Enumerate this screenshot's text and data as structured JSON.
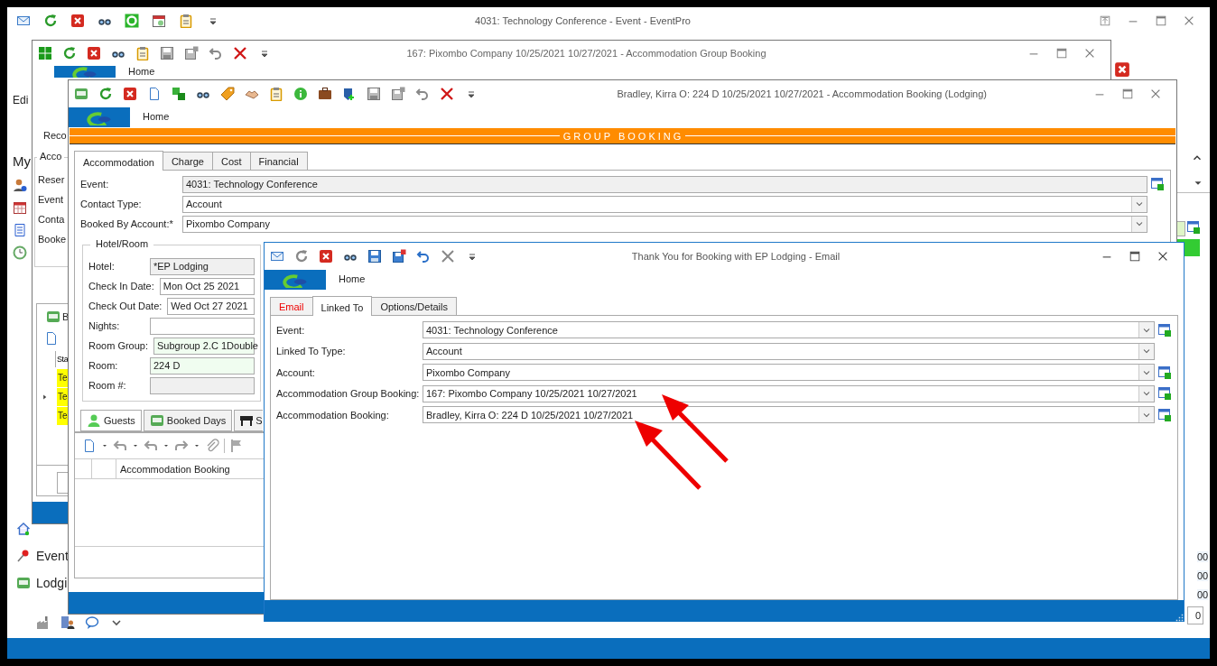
{
  "app_window": {
    "title": "4031: Technology Conference - Event - EventPro",
    "ribbon_label": "Edi",
    "panel_heading": "My",
    "nav_items": [
      {
        "label": "Event"
      },
      {
        "label": "Lodgi"
      }
    ],
    "list_values": [
      "00",
      "00",
      "00"
    ],
    "field_value": "0"
  },
  "group_booking_window": {
    "title": "167: Pixombo Company 10/25/2021 10/27/2021 - Accommodation Group Booking",
    "ribbon_tab": "Home",
    "tab": "Reco",
    "group_title": "Acco",
    "field_labels": [
      "Reser",
      "Event",
      "Conta",
      "Booke"
    ],
    "grid_tab": "B",
    "grid_column": "Sta",
    "grid_rows": [
      {
        "cell": "Te",
        "selected": false
      },
      {
        "cell": "Te",
        "selected": true
      },
      {
        "cell": "Te",
        "selected": false
      }
    ]
  },
  "accommodation_window": {
    "title": "Bradley, Kirra O: 224 D 10/25/2021 10/27/2021  - Accommodation Booking (Lodging)",
    "ribbon_tab": "Home",
    "banner": "GROUP BOOKING",
    "tabs": [
      {
        "label": "Accommodation",
        "selected": true
      },
      {
        "label": "Charge",
        "selected": false
      },
      {
        "label": "Cost",
        "selected": false
      },
      {
        "label": "Financial",
        "selected": false
      }
    ],
    "fields": [
      {
        "label": "Event:",
        "value": "4031: Technology Conference",
        "kind": "readonly",
        "lookup": true
      },
      {
        "label": "Contact Type:",
        "value": "Account",
        "kind": "dropdown",
        "lookup": false
      },
      {
        "label": "Booked By Account:*",
        "value": "Pixombo Company",
        "kind": "dropdown",
        "lookup": false
      }
    ],
    "group_title": "Hotel/Room",
    "room_fields": [
      {
        "label": "Hotel:",
        "value": "*EP Lodging",
        "kind": "readonly"
      },
      {
        "label": "Check In Date:",
        "value": "Mon Oct 25 2021",
        "kind": "date"
      },
      {
        "label": "Check Out Date:",
        "value": "Wed Oct 27 2021",
        "kind": "date"
      },
      {
        "label": "Nights:",
        "kind": "text"
      },
      {
        "label": "Room Group:",
        "value": "Subgroup 2.C 1Double",
        "kind": "assigned"
      },
      {
        "label": "Room:",
        "value": "224 D",
        "kind": "assigned"
      },
      {
        "label": "Room #:",
        "kind": "readonly"
      }
    ],
    "detail_tabs": [
      {
        "label": "Guests",
        "selected": true
      },
      {
        "label": "Booked Days",
        "selected": false
      },
      {
        "label": "S",
        "selected": false
      }
    ],
    "grid_column": "Accommodation Booking"
  },
  "email_window": {
    "title": "Thank You for Booking with EP Lodging - Email",
    "ribbon_tab": "Home",
    "tabs": [
      {
        "label": "Email",
        "selected": false,
        "alert": true
      },
      {
        "label": "Linked To",
        "selected": true,
        "alert": false
      },
      {
        "label": "Options/Details",
        "selected": false,
        "alert": false
      }
    ],
    "fields": [
      {
        "label": "Event:",
        "value": "4031: Technology Conference",
        "lookup": true
      },
      {
        "label": "Linked To Type:",
        "value": "Account",
        "lookup": false
      },
      {
        "label": "Account:",
        "value": "Pixombo Company",
        "lookup": true
      },
      {
        "label": "Accommodation Group Booking:",
        "value": "167: Pixombo Company 10/25/2021 10/27/2021",
        "lookup": true
      },
      {
        "label": "Accommodation Booking:",
        "value": "Bradley, Kirra O: 224 D 10/25/2021 10/27/2021",
        "lookup": true
      }
    ]
  }
}
